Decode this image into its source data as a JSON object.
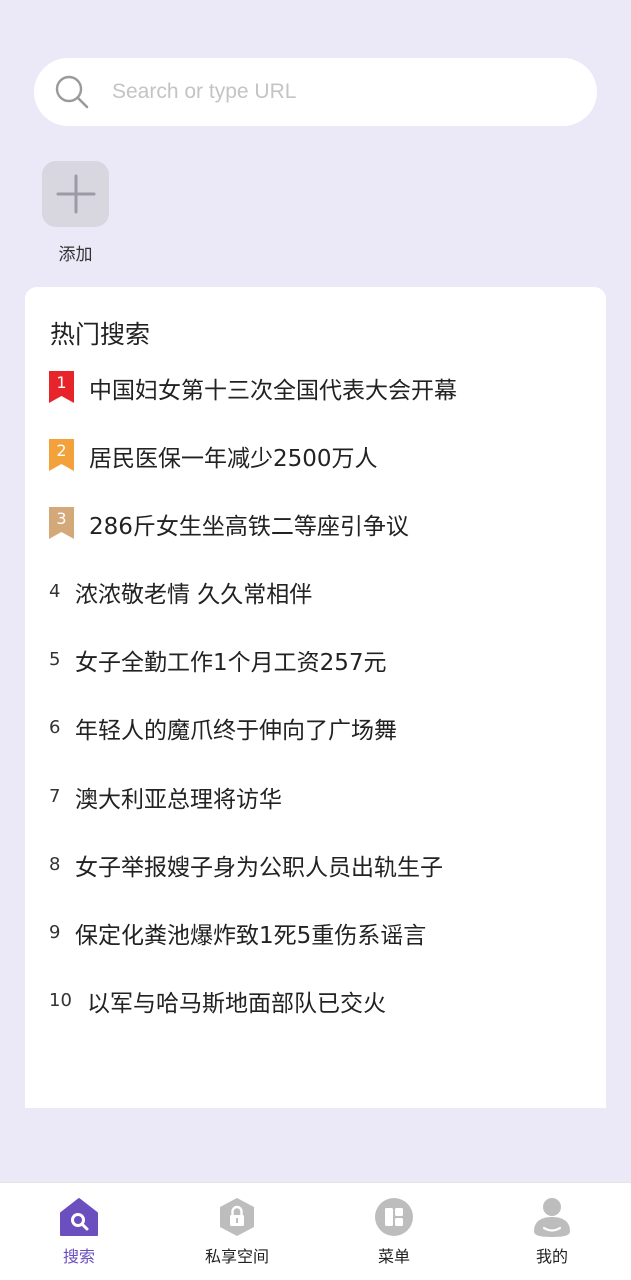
{
  "search": {
    "placeholder": "Search or type URL"
  },
  "shortcuts": {
    "add_label": "添加"
  },
  "hot": {
    "title": "热门搜索",
    "badge_colors": [
      "#e8242b",
      "#f3a13a",
      "#d4a97a"
    ],
    "items": [
      {
        "rank": "1",
        "text": "中国妇女第十三次全国代表大会开幕"
      },
      {
        "rank": "2",
        "text": "居民医保一年减少2500万人"
      },
      {
        "rank": "3",
        "text": "286斤女生坐高铁二等座引争议"
      },
      {
        "rank": "4",
        "text": "浓浓敬老情 久久常相伴"
      },
      {
        "rank": "5",
        "text": "女子全勤工作1个月工资257元"
      },
      {
        "rank": "6",
        "text": "年轻人的魔爪终于伸向了广场舞"
      },
      {
        "rank": "7",
        "text": "澳大利亚总理将访华"
      },
      {
        "rank": "8",
        "text": "女子举报嫂子身为公职人员出轨生子"
      },
      {
        "rank": "9",
        "text": "保定化粪池爆炸致1死5重伤系谣言"
      },
      {
        "rank": "10",
        "text": "以军与哈马斯地面部队已交火"
      }
    ]
  },
  "nav": {
    "accent": "#6b4fbf",
    "items": [
      {
        "label": "搜索",
        "icon": "search-home-icon",
        "active": true
      },
      {
        "label": "私享空间",
        "icon": "lock-icon",
        "active": false
      },
      {
        "label": "菜单",
        "icon": "menu-grid-icon",
        "active": false
      },
      {
        "label": "我的",
        "icon": "user-icon",
        "active": false
      }
    ]
  }
}
